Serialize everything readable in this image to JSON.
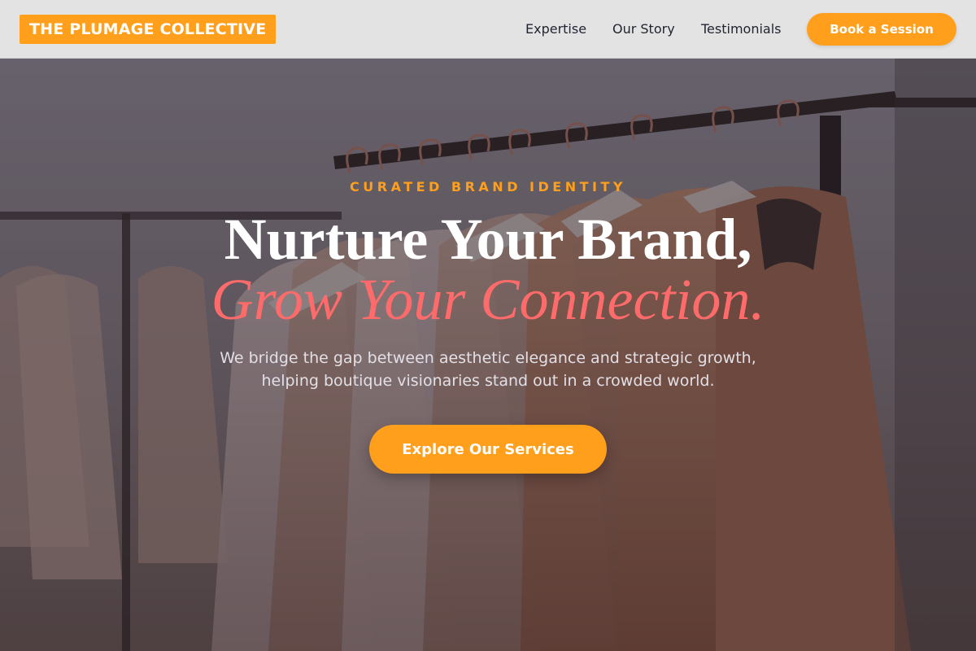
{
  "header": {
    "logo": "THE PLUMAGE COLLECTIVE",
    "nav": [
      {
        "label": "Expertise"
      },
      {
        "label": "Our Story"
      },
      {
        "label": "Testimonials"
      }
    ],
    "cta": "Book a Session"
  },
  "hero": {
    "eyebrow": "CURATED BRAND IDENTITY",
    "headline_line1": "Nurture Your Brand,",
    "headline_line2": "Grow Your Connection.",
    "subtitle": "We bridge the gap between aesthetic elegance and strategic growth, helping boutique visionaries stand out in a crowded world.",
    "cta": "Explore Our Services",
    "background_image": "clothing-rack-with-dresses"
  },
  "colors": {
    "accent": "#ff9f1c",
    "highlight": "#ff6b6b",
    "header_bg": "#e3e3e4",
    "nav_text": "#1f2430"
  }
}
